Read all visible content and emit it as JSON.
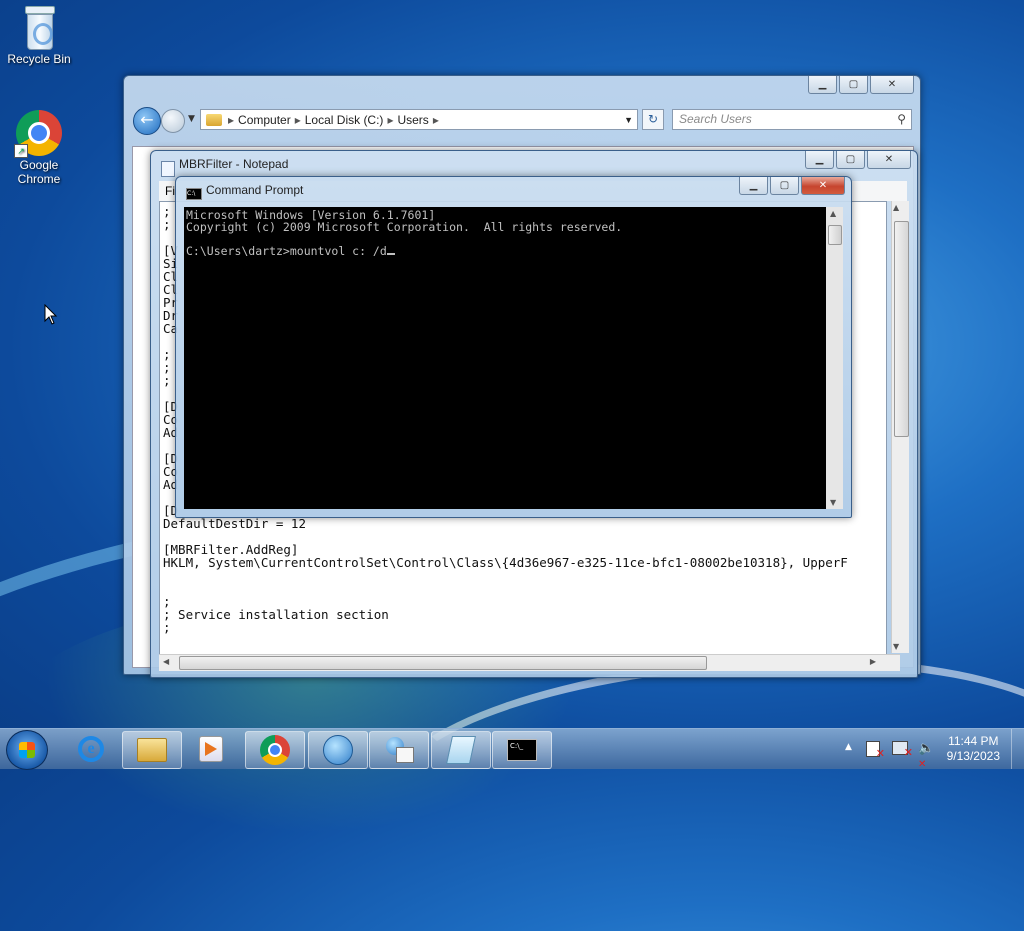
{
  "desktop": {
    "icons": [
      {
        "label": "Recycle Bin",
        "icon": "recycle-bin-icon"
      },
      {
        "label": "Google\nChrome",
        "icon": "chrome-icon"
      }
    ]
  },
  "explorer": {
    "breadcrumb": [
      "Computer",
      "Local Disk (C:)",
      "Users"
    ],
    "search_placeholder": "Search Users"
  },
  "notepad": {
    "title": "MBRFilter - Notepad",
    "menu_fragment": "Fi",
    "lines": [
      ";",
      ";",
      "",
      "[V",
      "Si",
      "Cl",
      "Cl",
      "Pr",
      "Dr",
      "Ca",
      "",
      ";",
      ";",
      ";",
      "",
      "[D",
      "Co",
      "Ad",
      "",
      "[D",
      "Co",
      "Ad",
      "",
      "[D",
      "DefaultDestDir = 12",
      "",
      "[MBRFilter.AddReg]",
      "HKLM, System\\CurrentControlSet\\Control\\Class\\{4d36e967-e325-11ce-bfc1-08002be10318}, UpperF",
      "",
      "",
      ";",
      "; Service installation section",
      ";"
    ]
  },
  "cmd": {
    "title": "Command Prompt",
    "line1": "Microsoft Windows [Version 6.1.7601]",
    "line2": "Copyright (c) 2009 Microsoft Corporation.  All rights reserved.",
    "line3": "",
    "prompt": "C:\\Users\\dartz>mountvol c: /d"
  },
  "taskbar": {
    "pinned": [
      "internet-explorer-icon",
      "file-explorer-icon",
      "media-player-icon",
      "chrome-icon",
      "network-globe-icon",
      "network-settings-icon",
      "notepad-icon",
      "command-prompt-icon"
    ],
    "active": "command-prompt-icon",
    "time": "11:44 PM",
    "date": "9/13/2023"
  }
}
